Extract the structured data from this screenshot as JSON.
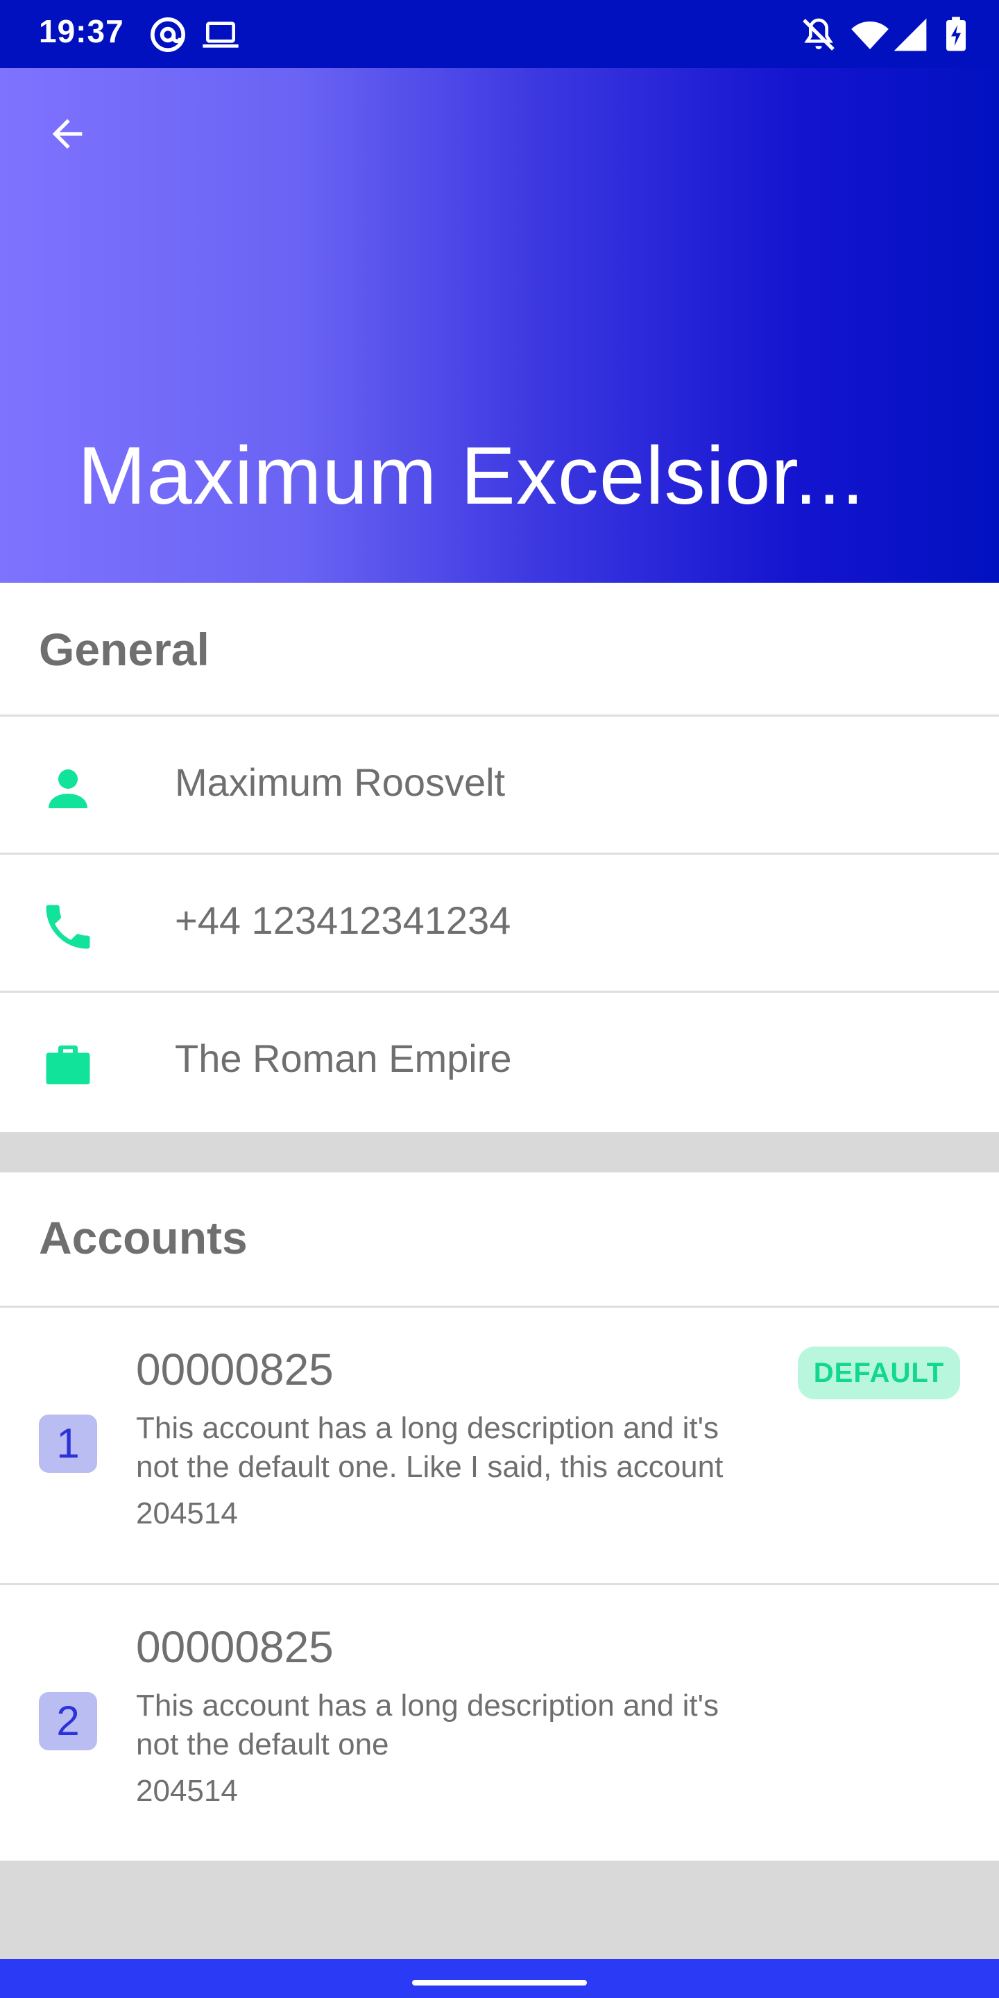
{
  "status_bar": {
    "time": "19:37",
    "icons": [
      "at-sign-icon",
      "laptop-icon",
      "notifications-off-icon",
      "wifi-icon",
      "signal-icon",
      "battery-charging-icon"
    ]
  },
  "header": {
    "title": "Maximum Excelsior...",
    "back_icon": "arrow-back-icon",
    "gradient_start": "#7e73ff",
    "gradient_end": "#0111c0"
  },
  "general": {
    "title": "General",
    "items": [
      {
        "icon": "person-icon",
        "text": "Maximum Roosvelt"
      },
      {
        "icon": "phone-icon",
        "text": "+44 123412341234"
      },
      {
        "icon": "briefcase-icon",
        "text": "The Roman Empire"
      }
    ],
    "icon_color": "#12e39a"
  },
  "accounts": {
    "title": "Accounts",
    "items": [
      {
        "badge": "1",
        "number": "00000825",
        "description": "This account has a long description and it's not the default one. Like I said, this account",
        "code": "204514",
        "default_label": "DEFAULT"
      },
      {
        "badge": "2",
        "number": "00000825",
        "description": "This account has a long description and it's not the default one",
        "code": "204514"
      }
    ]
  }
}
